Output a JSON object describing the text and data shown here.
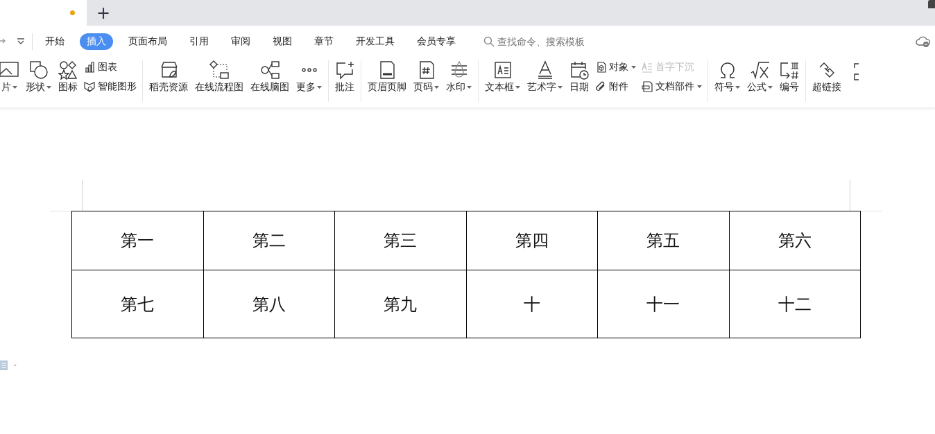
{
  "title_bar": {
    "document_tab": {
      "unsaved": true
    },
    "new_tab_button": "+"
  },
  "menu": {
    "tabs": [
      {
        "label": "开始",
        "selected": false
      },
      {
        "label": "插入",
        "selected": true
      },
      {
        "label": "页面布局",
        "selected": false
      },
      {
        "label": "引用",
        "selected": false
      },
      {
        "label": "审阅",
        "selected": false
      },
      {
        "label": "视图",
        "selected": false
      },
      {
        "label": "章节",
        "selected": false
      },
      {
        "label": "开发工具",
        "selected": false
      },
      {
        "label": "会员专享",
        "selected": false
      }
    ],
    "search": {
      "placeholder": "查找命令、搜索模板"
    }
  },
  "ribbon": {
    "groups": [
      {
        "items": [
          {
            "kind": "large",
            "label": "片",
            "dropdown": true
          },
          {
            "kind": "large",
            "label": "形状",
            "dropdown": true
          },
          {
            "kind": "large",
            "label": "图标",
            "dropdown": false
          },
          {
            "kind": "pair",
            "items": [
              {
                "label": "图表",
                "dropdown": false,
                "disabled": false
              },
              {
                "label": "智能图形",
                "dropdown": false,
                "disabled": false
              }
            ]
          }
        ]
      },
      {
        "items": [
          {
            "kind": "large",
            "label": "稻壳资源",
            "dropdown": false
          },
          {
            "kind": "large",
            "label": "在线流程图",
            "dropdown": false
          },
          {
            "kind": "large",
            "label": "在线脑图",
            "dropdown": false
          },
          {
            "kind": "large",
            "label": "更多",
            "dropdown": true
          }
        ]
      },
      {
        "items": [
          {
            "kind": "large",
            "label": "批注",
            "dropdown": false
          }
        ]
      },
      {
        "items": [
          {
            "kind": "large",
            "label": "页眉页脚",
            "dropdown": false
          },
          {
            "kind": "large",
            "label": "页码",
            "dropdown": true
          },
          {
            "kind": "large",
            "label": "水印",
            "dropdown": true
          }
        ]
      },
      {
        "items": [
          {
            "kind": "large",
            "label": "文本框",
            "dropdown": true
          },
          {
            "kind": "large",
            "label": "艺术字",
            "dropdown": true
          },
          {
            "kind": "large",
            "label": "日期",
            "dropdown": false
          },
          {
            "kind": "pair",
            "items": [
              {
                "label": "对象",
                "dropdown": true,
                "disabled": false
              },
              {
                "label": "附件",
                "dropdown": false,
                "disabled": false
              }
            ]
          },
          {
            "kind": "pair",
            "items": [
              {
                "label": "首字下沉",
                "dropdown": false,
                "disabled": true
              },
              {
                "label": "文档部件",
                "dropdown": true,
                "disabled": false
              }
            ]
          }
        ]
      },
      {
        "items": [
          {
            "kind": "large",
            "label": "符号",
            "dropdown": true
          },
          {
            "kind": "large",
            "label": "公式",
            "dropdown": true
          },
          {
            "kind": "large",
            "label": "编号",
            "dropdown": false
          }
        ]
      },
      {
        "items": [
          {
            "kind": "large",
            "label": "超链接",
            "dropdown": false
          }
        ]
      }
    ]
  },
  "document": {
    "table": {
      "rows": [
        [
          "第一",
          "第二",
          "第三",
          "第四",
          "第五",
          "第六"
        ],
        [
          "第七",
          "第八",
          "第九",
          "十",
          "十一",
          "十二"
        ]
      ]
    }
  }
}
